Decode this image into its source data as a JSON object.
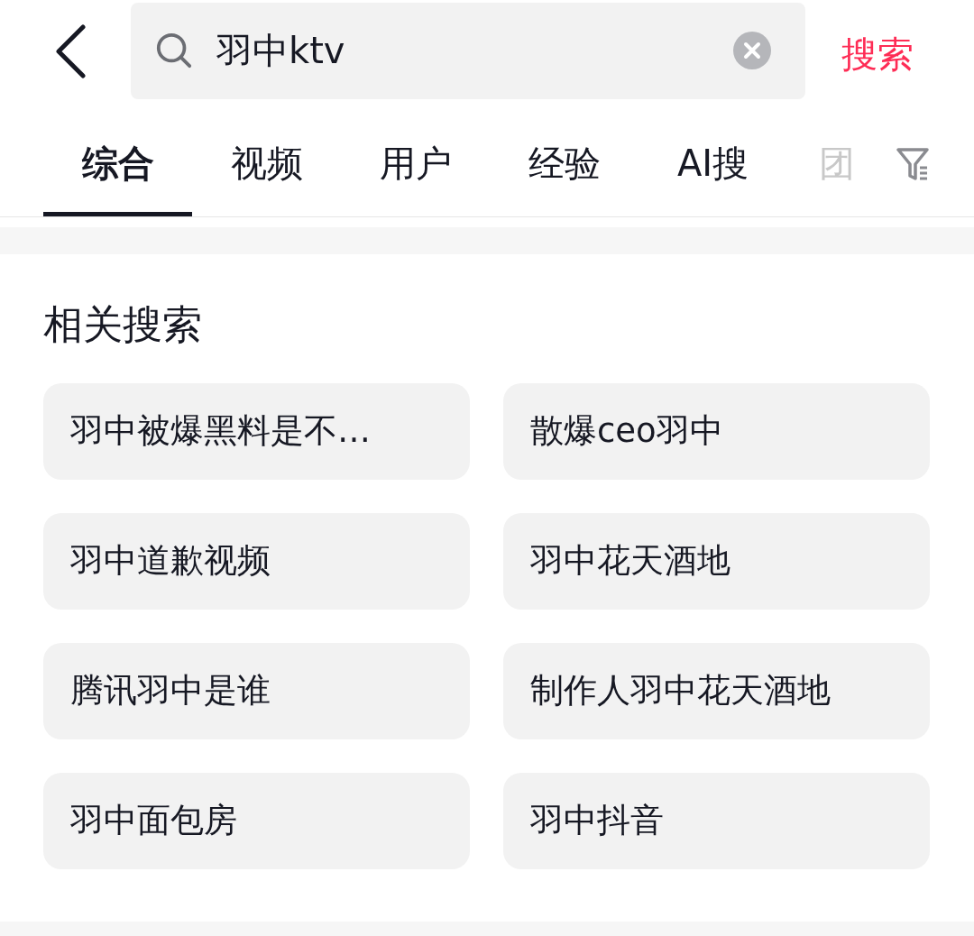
{
  "search": {
    "value": "羽中ktv",
    "action": "搜索"
  },
  "tabs": [
    {
      "label": "综合",
      "selected": true,
      "faded": false
    },
    {
      "label": "视频",
      "selected": false,
      "faded": false
    },
    {
      "label": "用户",
      "selected": false,
      "faded": false
    },
    {
      "label": "经验",
      "selected": false,
      "faded": false
    },
    {
      "label": "AI搜",
      "selected": false,
      "faded": false
    },
    {
      "label": "团",
      "selected": false,
      "faded": true
    }
  ],
  "related": {
    "title": "相关搜索",
    "items": [
      "羽中被爆黑料是不…",
      "散爆ceo羽中",
      "羽中道歉视频",
      "羽中花天酒地",
      "腾讯羽中是谁",
      "制作人羽中花天酒地",
      "羽中面包房",
      "羽中抖音"
    ]
  }
}
